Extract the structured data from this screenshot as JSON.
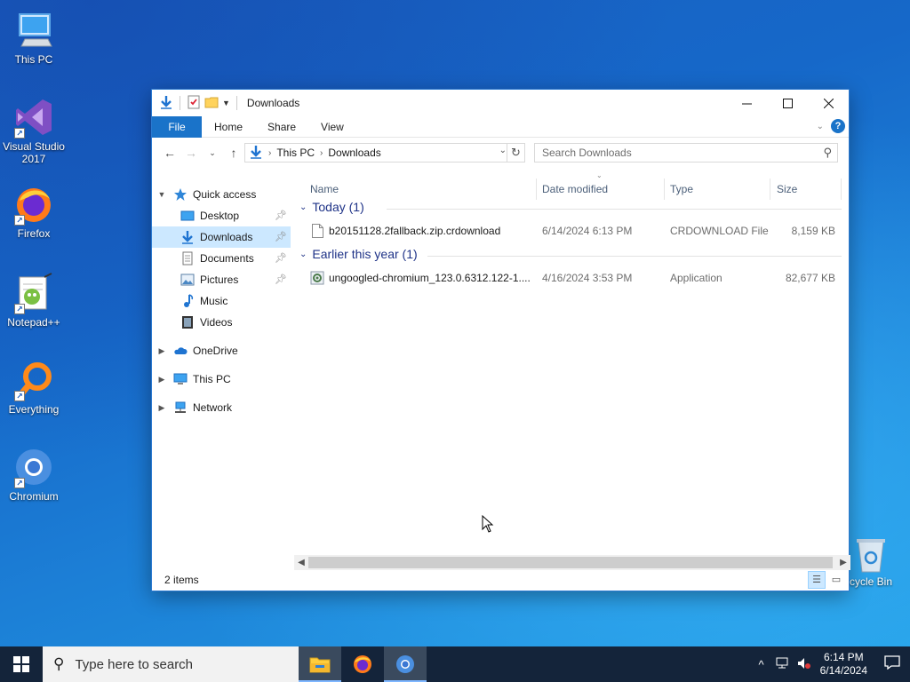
{
  "desktop": {
    "icons": [
      {
        "label": "This PC"
      },
      {
        "label": "Visual Studio 2017"
      },
      {
        "label": "Firefox"
      },
      {
        "label": "Notepad++"
      },
      {
        "label": "Everything"
      },
      {
        "label": "Chromium"
      },
      {
        "label": "Recycle Bin"
      }
    ]
  },
  "window": {
    "title": "Downloads",
    "tabs": [
      "File",
      "Home",
      "Share",
      "View"
    ],
    "address": {
      "crumbs": [
        "This PC",
        "Downloads"
      ]
    },
    "search": {
      "placeholder": "Search Downloads"
    },
    "nav": {
      "quick_access": "Quick access",
      "items": [
        "Desktop",
        "Downloads",
        "Documents",
        "Pictures",
        "Music",
        "Videos"
      ],
      "onedrive": "OneDrive",
      "this_pc": "This PC",
      "network": "Network"
    },
    "columns": [
      "Name",
      "Date modified",
      "Type",
      "Size"
    ],
    "groups": [
      {
        "label": "Today (1)",
        "files": [
          {
            "name": "b20151128.2fallback.zip.crdownload",
            "date": "6/14/2024 6:13 PM",
            "type": "CRDOWNLOAD File",
            "size": "8,159 KB"
          }
        ]
      },
      {
        "label": "Earlier this year (1)",
        "files": [
          {
            "name": "ungoogled-chromium_123.0.6312.122-1....",
            "date": "4/16/2024 3:53 PM",
            "type": "Application",
            "size": "82,677 KB"
          }
        ]
      }
    ],
    "status": "2 items"
  },
  "taskbar": {
    "search_placeholder": "Type here to search",
    "time": "6:14 PM",
    "date": "6/14/2024"
  },
  "colors": {
    "accent": "#1a73c9",
    "selection": "#cce8ff",
    "group_header": "#1e3287",
    "taskbar": "#14243a"
  }
}
